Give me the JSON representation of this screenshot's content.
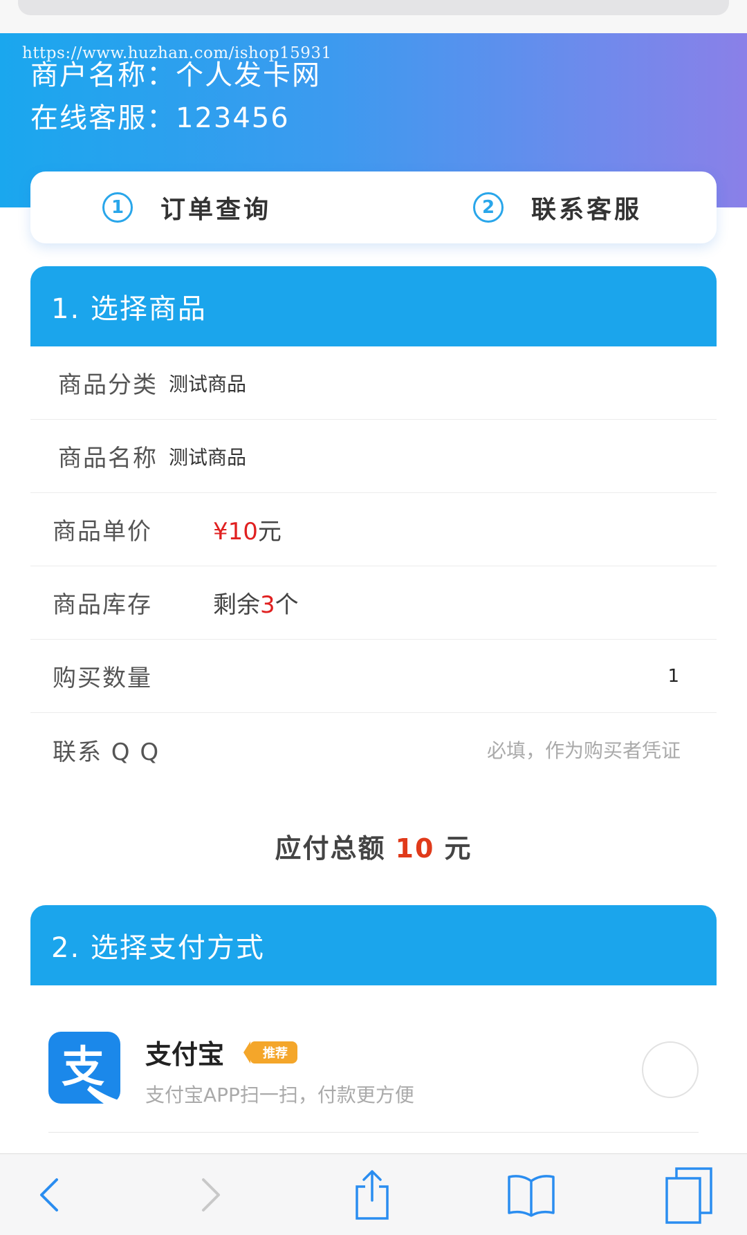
{
  "watermark": "https://www.huzhan.com/ishop15931",
  "header": {
    "merchant_label": "商户名称：个人发卡网",
    "service_label": "在线客服：123456"
  },
  "actions": [
    {
      "num": "1",
      "label": "订单查询"
    },
    {
      "num": "2",
      "label": "联系客服"
    }
  ],
  "section1": {
    "title": "1. 选择商品",
    "category": {
      "label": "商品分类",
      "value": "测试商品"
    },
    "name": {
      "label": "商品名称",
      "value": "测试商品"
    },
    "price": {
      "label": "商品单价",
      "currency": "¥",
      "amount": "10",
      "unit": "元"
    },
    "stock": {
      "label": "商品库存",
      "prefix": "剩余",
      "count": "3",
      "unit": "个"
    },
    "quantity": {
      "label": "购买数量",
      "value": "1"
    },
    "qq": {
      "label": "联系 Q Q",
      "placeholder": "必填，作为购买者凭证"
    }
  },
  "total": {
    "label": "应付总额",
    "amount": "10",
    "unit": "元"
  },
  "section2": {
    "title": "2. 选择支付方式",
    "method": {
      "name": "支付宝",
      "badge": "推荐",
      "desc": "支付宝APP扫一扫，付款更方便",
      "logo_glyph": "支"
    }
  },
  "colors": {
    "primary": "#1ba5ec",
    "price_red": "#e02020",
    "alipay_blue": "#1b88ea",
    "badge_orange": "#f4a62a"
  },
  "toolbar_icons": [
    "back-icon",
    "forward-icon",
    "share-icon",
    "bookmarks-icon",
    "tabs-icon"
  ]
}
